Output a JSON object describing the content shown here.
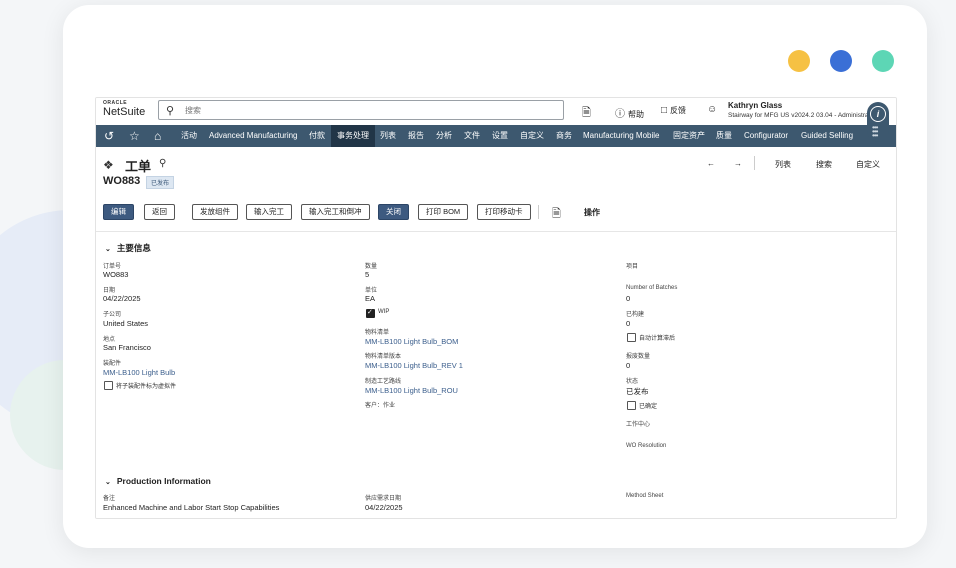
{
  "frame": {
    "dots": [
      "#f6c143",
      "#3a6fd6",
      "#5dd6b5"
    ]
  },
  "topbar": {
    "logo_oracle": "ORACLE",
    "logo_netsuite": "NetSuite",
    "search_placeholder": "搜索",
    "help": "帮助",
    "feedback": "反馈",
    "user_name": "Kathryn Glass",
    "user_role": "Stairway for MFG US v2024.2 03.04 - Administrator"
  },
  "nav": {
    "items": [
      "活动",
      "Advanced Manufacturing",
      "付款",
      "事务处理",
      "列表",
      "报告",
      "分析",
      "文件",
      "设置",
      "自定义",
      "商务",
      "Manufacturing Mobile",
      "固定资产",
      "质量",
      "Configurator",
      "Guided Selling"
    ],
    "active_index": 3
  },
  "header": {
    "record_type": "工单",
    "record_id": "WO883",
    "status_badge": "已发布",
    "prev": "←",
    "next": "→",
    "list": "列表",
    "search": "搜索",
    "customize": "自定义"
  },
  "toolbar": {
    "edit": "编辑",
    "back": "返回",
    "release_components": "发放组件",
    "enter_completion": "输入完工",
    "enter_completion_backflush": "输入完工和倒冲",
    "close": "关闭",
    "print_bom": "打印 BOM",
    "print_traveler": "打印移动卡",
    "actions": "操作"
  },
  "primary": {
    "title": "主要信息",
    "col1": {
      "order_no_label": "订单号",
      "order_no": "WO883",
      "date_label": "日期",
      "date": "04/22/2025",
      "subsidiary_label": "子公司",
      "subsidiary": "United States",
      "location_label": "地点",
      "location": "San Francisco",
      "assembly_label": "装配件",
      "assembly": "MM-LB100 Light Bulb",
      "phantom_label": "将子装配件标为虚拟件"
    },
    "col2": {
      "quantity_label": "数量",
      "quantity": "5",
      "units_label": "单位",
      "units": "EA",
      "wip_label": "WIP",
      "bom_label": "物料清单",
      "bom": "MM-LB100 Light Bulb_BOM",
      "bom_rev_label": "物料清单版本",
      "bom_rev": "MM-LB100 Light Bulb_REV 1",
      "routing_label": "制造工艺路线",
      "routing": "MM-LB100 Light Bulb_ROU",
      "customer_job_label": "客户：作业"
    },
    "col3": {
      "project_label": "项目",
      "batches_label": "Number of Batches",
      "batches": "0",
      "built_label": "已构建",
      "built": "0",
      "auto_calc_label": "自动计算滞后",
      "scrap_label": "报废数量",
      "scrap": "0",
      "status_label": "状态",
      "status": "已发布",
      "firmed_label": "已确定",
      "work_center_label": "工作中心",
      "wo_resolution_label": "WO Resolution"
    }
  },
  "production": {
    "title": "Production Information",
    "memo_label": "备注",
    "memo": "Enhanced Machine and Labor Start Stop Capabilities",
    "supply_date_label": "供应需求日期",
    "supply_date": "04/22/2025",
    "method_sheet_label": "Method Sheet"
  }
}
